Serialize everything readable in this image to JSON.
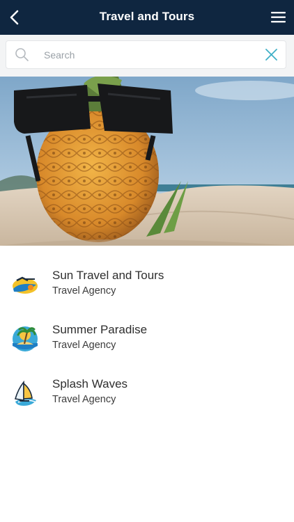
{
  "header": {
    "title": "Travel and Tours",
    "back_icon": "chevron-left-icon",
    "menu_icon": "hamburger-menu-icon",
    "background_color": "#0f2640"
  },
  "search": {
    "placeholder": "Search",
    "search_icon": "search-icon",
    "clear_icon": "close-icon",
    "accent_color": "#3fb0c6"
  },
  "hero": {
    "image": "pineapple-with-sunglasses-on-beach"
  },
  "listings": [
    {
      "name": "Sun Travel and Tours",
      "category": "Travel Agency",
      "icon": "sun-travel-logo"
    },
    {
      "name": "Summer Paradise",
      "category": "Travel Agency",
      "icon": "palm-island-logo"
    },
    {
      "name": "Splash Waves",
      "category": "Travel Agency",
      "icon": "windsurf-logo"
    }
  ]
}
